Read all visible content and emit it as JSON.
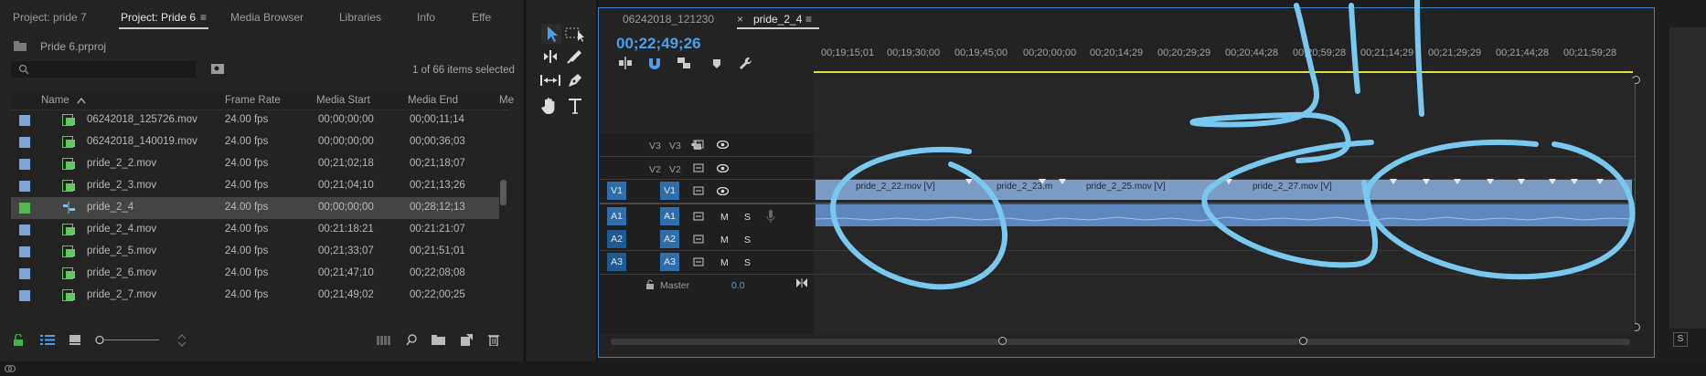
{
  "project_panel": {
    "tabs": [
      "Project: pride 7",
      "Project: Pride 6",
      "Media Browser",
      "Libraries",
      "Info",
      "Effe"
    ],
    "active_tab": "Project: Pride 6",
    "file_name": "Pride 6.prproj",
    "search_placeholder": "",
    "selection_count": "1 of 66 items selected",
    "columns": [
      "Name",
      "Frame Rate",
      "Media Start",
      "Media End",
      "Me"
    ],
    "rows": [
      {
        "name": "06242018_125726.mov",
        "fps": "24.00 fps",
        "start": "00;00;00;00",
        "end": "00;00;11;14",
        "color": "#7fa5d6",
        "selected": false
      },
      {
        "name": "06242018_140019.mov",
        "fps": "24.00 fps",
        "start": "00;00;00;00",
        "end": "00;00;36;03",
        "color": "#7fa5d6",
        "selected": false
      },
      {
        "name": "pride_2_2.mov",
        "fps": "24.00 fps",
        "start": "00;21;02;18",
        "end": "00;21;18;07",
        "color": "#7fa5d6",
        "selected": false
      },
      {
        "name": "pride_2_3.mov",
        "fps": "24.00 fps",
        "start": "00;21;04;10",
        "end": "00;21;13;26",
        "color": "#7fa5d6",
        "selected": false
      },
      {
        "name": "pride_2_4",
        "fps": "24.00 fps",
        "start": "00;00;00;00",
        "end": "00;28;12;13",
        "color": "#4eba4e",
        "selected": true
      },
      {
        "name": "pride_2_4.mov",
        "fps": "24.00 fps",
        "start": "00:21:18:21",
        "end": "00:21:21:07",
        "color": "#7fa5d6",
        "selected": false
      },
      {
        "name": "pride_2_5.mov",
        "fps": "24.00 fps",
        "start": "00;21;33;07",
        "end": "00;21;51;01",
        "color": "#7fa5d6",
        "selected": false
      },
      {
        "name": "pride_2_6.mov",
        "fps": "24.00 fps",
        "start": "00;21;47;10",
        "end": "00;22;08;08",
        "color": "#7fa5d6",
        "selected": false
      },
      {
        "name": "pride_2_7.mov",
        "fps": "24.00 fps",
        "start": "00;21;49;02",
        "end": "00;22;00;25",
        "color": "#7fa5d6",
        "selected": false
      }
    ]
  },
  "timeline": {
    "tabs": [
      "06242018_121230",
      "pride_2_4"
    ],
    "active_tab": "pride_2_4",
    "close_glyph": "×",
    "menu_glyph": "≡",
    "timecode": "00;22;49;26",
    "ruler_labels": [
      "00;19;15;01",
      "00;19;30;00",
      "00;19;45;00",
      "00;20;00;00",
      "00;20;14;29",
      "00;20;29;29",
      "00;20;44;28",
      "00;20;59;28",
      "00;21;14;29",
      "00;21;29;29",
      "00;21;44;28",
      "00;21;59;28"
    ],
    "tracks": [
      {
        "src": "",
        "name": "V3",
        "active": false
      },
      {
        "src": "",
        "name": "V2",
        "active": false
      },
      {
        "src": "V1",
        "name": "V1",
        "active": true
      },
      {
        "src": "A1",
        "name": "A1",
        "active": true
      },
      {
        "src": "A2",
        "name": "A2",
        "active": true
      },
      {
        "src": "A3",
        "name": "A3",
        "active": true
      }
    ],
    "master_label": "Master",
    "master_value": "0.0",
    "mute_label": "M",
    "solo_label": "S",
    "clips": [
      "pride_2_22.mov [V]",
      "pride_2_23.m",
      "pride_2_25.mov [V]",
      "pride_2_27.mov [V]"
    ]
  },
  "colors": {
    "accent": "#4aa0ea",
    "annotation": "#78c8f0",
    "clip_video": "#7c9cc6",
    "clip_audio": "#5e86bf",
    "playhead_bar": "#e1e13a"
  }
}
